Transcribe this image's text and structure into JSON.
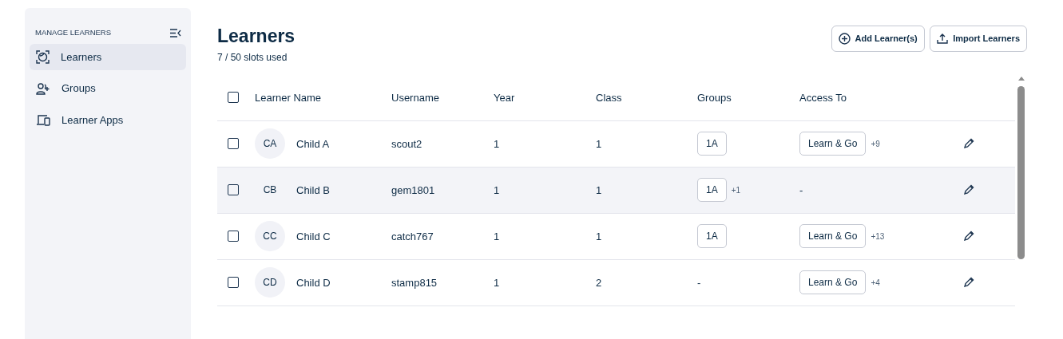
{
  "sidebar": {
    "heading": "MANAGE LEARNERS",
    "items": [
      {
        "label": "Learners",
        "selected": true
      },
      {
        "label": "Groups",
        "selected": false
      },
      {
        "label": "Learner Apps",
        "selected": false
      }
    ]
  },
  "header": {
    "title": "Learners",
    "subtitle": "7 / 50 slots used",
    "buttons": [
      {
        "label": "Add Learner(s)"
      },
      {
        "label": "Import Learners"
      }
    ]
  },
  "table": {
    "columns": [
      "Learner Name",
      "Username",
      "Year",
      "Class",
      "Groups",
      "Access To"
    ],
    "all_checked": false,
    "rows": [
      {
        "checked": false,
        "hovered": false,
        "initials": "CA",
        "name": "Child A",
        "username": "scout2",
        "year": "1",
        "class": "1",
        "group": "1A",
        "group_more": "",
        "access": "Learn & Go",
        "access_more": "+9"
      },
      {
        "checked": false,
        "hovered": true,
        "initials": "CB",
        "name": "Child B",
        "username": "gem1801",
        "year": "1",
        "class": "1",
        "group": "1A",
        "group_more": "+1",
        "access": "-",
        "access_more": ""
      },
      {
        "checked": false,
        "hovered": false,
        "initials": "CC",
        "name": "Child C",
        "username": "catch767",
        "year": "1",
        "class": "1",
        "group": "1A",
        "group_more": "",
        "access": "Learn & Go",
        "access_more": "+13"
      },
      {
        "checked": false,
        "hovered": false,
        "initials": "CD",
        "name": "Child D",
        "username": "stamp815",
        "year": "1",
        "class": "2",
        "group": "-",
        "group_more": "",
        "access": "Learn & Go",
        "access_more": "+4"
      }
    ]
  }
}
